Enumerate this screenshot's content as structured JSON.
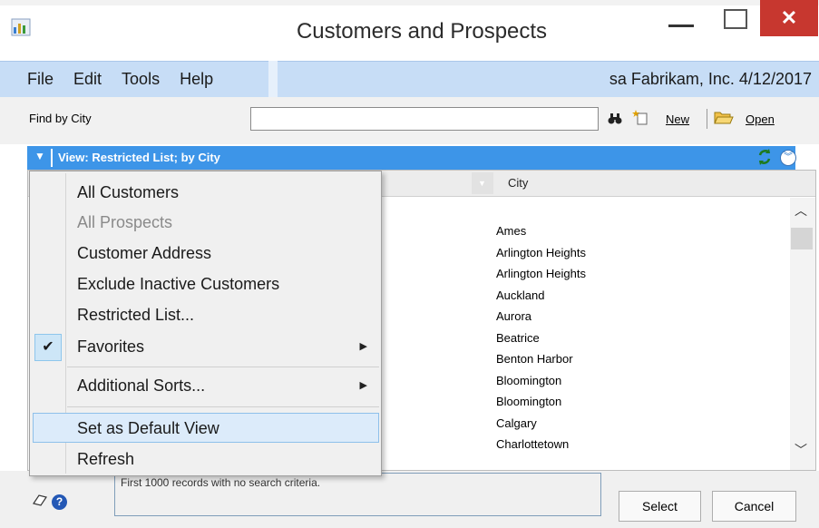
{
  "window": {
    "title": "Customers and Prospects",
    "minimize_glyph": "",
    "close_glyph": "✕"
  },
  "menubar": {
    "items": [
      "File",
      "Edit",
      "Tools",
      "Help"
    ],
    "company_info": "sa  Fabrikam, Inc.  4/12/2017"
  },
  "find": {
    "label": "Find by City",
    "value": "",
    "new_label": "New",
    "open_label": "Open"
  },
  "viewbar": {
    "label": "View: Restricted List; by City"
  },
  "list": {
    "column_header": "City",
    "rows": [
      "Ames",
      "Arlington Heights",
      "Arlington Heights",
      "Auckland",
      "Aurora",
      "Beatrice",
      "Benton Harbor",
      "Bloomington",
      "Bloomington",
      "Calgary",
      "Charlottetown"
    ]
  },
  "status": {
    "text": "First 1000 records with no search criteria."
  },
  "buttons": {
    "select": "Select",
    "cancel": "Cancel"
  },
  "view_menu": {
    "items": [
      {
        "label": "All Customers",
        "enabled": true
      },
      {
        "label": "All Prospects",
        "enabled": false
      },
      {
        "label": "Customer Address",
        "enabled": true
      },
      {
        "label": "Exclude Inactive Customers",
        "enabled": true
      },
      {
        "label": "Restricted List...",
        "enabled": true
      },
      {
        "label": "Favorites",
        "enabled": true,
        "checked": true,
        "submenu": true
      },
      {
        "label": "Additional Sorts...",
        "enabled": true,
        "submenu": true
      },
      {
        "label": "Set as Default View",
        "enabled": true,
        "highlighted": true
      },
      {
        "label": "Refresh",
        "enabled": true
      }
    ],
    "check_glyph": "✔",
    "submenu_glyph": "▶"
  },
  "colors": {
    "viewbar": "#3d95e8",
    "menubar": "#c7ddf6",
    "close_button": "#c7372f"
  }
}
